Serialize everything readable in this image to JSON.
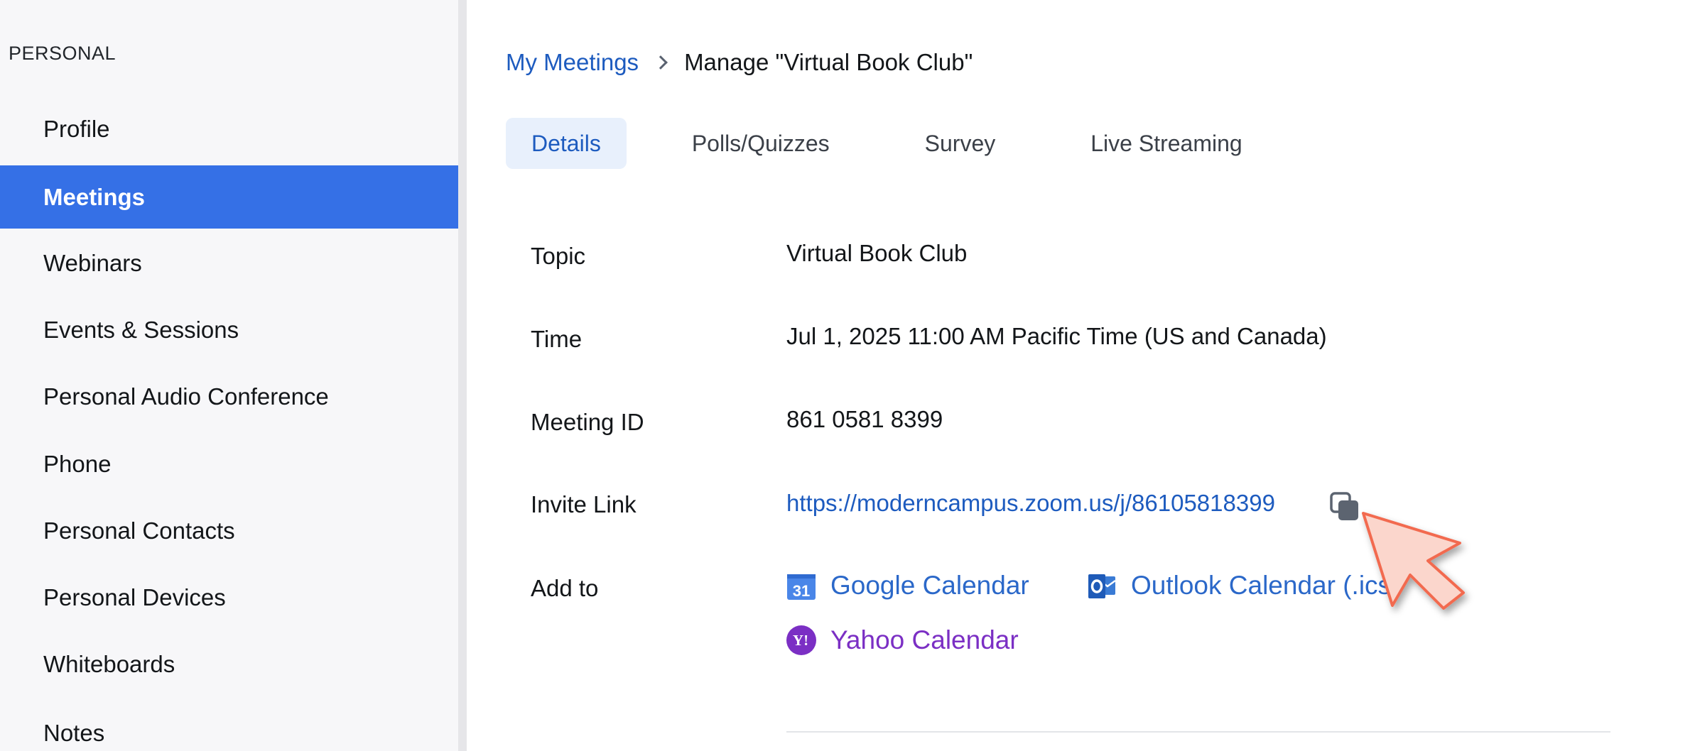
{
  "sidebar": {
    "section": "PERSONAL",
    "items": [
      {
        "label": "Profile"
      },
      {
        "label": "Meetings"
      },
      {
        "label": "Webinars"
      },
      {
        "label": "Events & Sessions"
      },
      {
        "label": "Personal Audio Conference"
      },
      {
        "label": "Phone"
      },
      {
        "label": "Personal Contacts"
      },
      {
        "label": "Personal Devices"
      },
      {
        "label": "Whiteboards"
      },
      {
        "label": "Notes"
      }
    ],
    "active_index": 1
  },
  "breadcrumb": {
    "parent": "My Meetings",
    "current": "Manage \"Virtual Book Club\""
  },
  "tabs": [
    {
      "label": "Details"
    },
    {
      "label": "Polls/Quizzes"
    },
    {
      "label": "Survey"
    },
    {
      "label": "Live Streaming"
    }
  ],
  "details": {
    "topic": {
      "label": "Topic",
      "value": "Virtual Book Club"
    },
    "time": {
      "label": "Time",
      "value": "Jul 1, 2025 11:00 AM Pacific Time (US and Canada)"
    },
    "meeting_id": {
      "label": "Meeting ID",
      "value": "861 0581 8399"
    },
    "invite_link": {
      "label": "Invite Link",
      "value": "https://moderncampus.zoom.us/j/86105818399"
    },
    "add_to": {
      "label": "Add to",
      "google": "Google Calendar",
      "outlook": "Outlook Calendar (.ics)",
      "yahoo": "Yahoo Calendar"
    }
  },
  "icons": {
    "copy": "copy-icon",
    "google_calendar": "google-calendar-icon",
    "outlook": "outlook-icon",
    "yahoo": "yahoo-icon",
    "cursor": "mouse-cursor-icon"
  },
  "colors": {
    "accent": "#3570e6",
    "link": "#1d5bbf",
    "yahoo": "#7b2fc4",
    "cursor": "#f26b4f"
  }
}
